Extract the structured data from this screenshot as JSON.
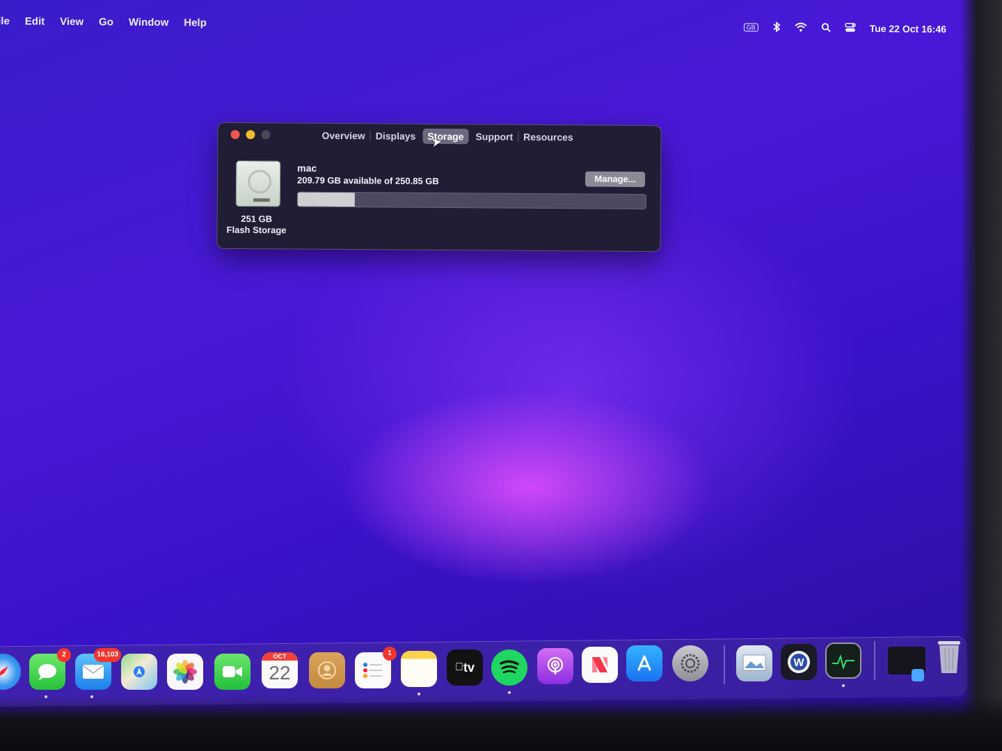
{
  "menubar": {
    "items": [
      "File",
      "Edit",
      "View",
      "Go",
      "Window",
      "Help"
    ],
    "keyboard_badge": "GB",
    "status_icons": [
      "bluetooth-icon",
      "wifi-icon",
      "spotlight-search-icon",
      "control-center-icon"
    ],
    "datetime": "Tue 22 Oct  16:46"
  },
  "window": {
    "tabs": [
      "Overview",
      "Displays",
      "Storage",
      "Support",
      "Resources"
    ],
    "active_tab": "Storage",
    "disk": {
      "capacity": "251 GB",
      "type": "Flash Storage",
      "volume_name": "mac",
      "availability": "209.79 GB available of 250.85 GB",
      "used_fraction": 0.164,
      "manage_label": "Manage..."
    }
  },
  "dock": {
    "apps": [
      {
        "name": "Safari",
        "icon": "safari-icon"
      },
      {
        "name": "Messages",
        "icon": "messages-icon",
        "badge": "2"
      },
      {
        "name": "Mail",
        "icon": "mail-icon",
        "badge": "16,103"
      },
      {
        "name": "Maps",
        "icon": "maps-icon"
      },
      {
        "name": "Photos",
        "icon": "photos-icon"
      },
      {
        "name": "FaceTime",
        "icon": "facetime-icon"
      },
      {
        "name": "Calendar",
        "icon": "calendar-icon",
        "month": "OCT",
        "day": "22"
      },
      {
        "name": "Contacts",
        "icon": "contacts-icon"
      },
      {
        "name": "Reminders",
        "icon": "reminders-icon",
        "badge": "1"
      },
      {
        "name": "Notes",
        "icon": "notes-icon"
      },
      {
        "name": "Apple TV",
        "icon": "appletv-icon",
        "label": "tv"
      },
      {
        "name": "Spotify",
        "icon": "spotify-icon"
      },
      {
        "name": "Podcasts",
        "icon": "podcasts-icon"
      },
      {
        "name": "News",
        "icon": "news-icon"
      },
      {
        "name": "App Store",
        "icon": "appstore-icon"
      },
      {
        "name": "System Preferences",
        "icon": "system-preferences-icon"
      },
      {
        "name": "Preview",
        "icon": "preview-icon"
      },
      {
        "name": "W App",
        "icon": "w-app-icon"
      },
      {
        "name": "Activity Monitor",
        "icon": "activity-monitor-icon"
      },
      {
        "name": "Minimized Window",
        "icon": "minimized-window-icon"
      },
      {
        "name": "Trash",
        "icon": "trash-icon"
      }
    ]
  }
}
